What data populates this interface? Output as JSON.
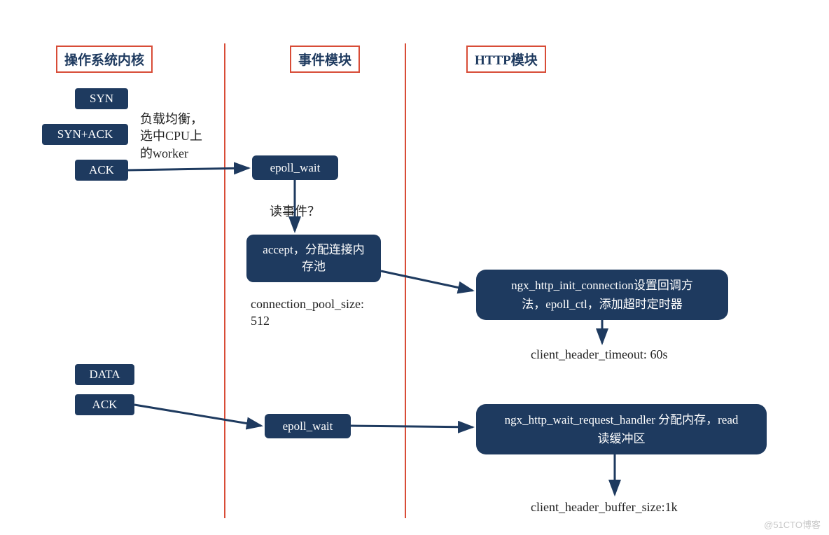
{
  "columns": {
    "kernel_title": "操作系统内核",
    "event_title": "事件模块",
    "http_title": "HTTP模块"
  },
  "kernel": {
    "syn": "SYN",
    "synack": "SYN+ACK",
    "ack": "ACK",
    "data": "DATA",
    "ack2": "ACK",
    "lb_note_line1": "负载均衡，",
    "lb_note_line2": "选中CPU上",
    "lb_note_line3": "的worker"
  },
  "event": {
    "epoll_wait_1": "epoll_wait",
    "epoll_wait_2": "epoll_wait",
    "read_event_q": "读事件？",
    "accept_box_line1": "accept，分配连接内",
    "accept_box_line2": "存池",
    "conn_pool_line1": "connection_pool_size:",
    "conn_pool_line2": "512"
  },
  "http": {
    "init_conn_line1": "ngx_http_init_connection设置回调方",
    "init_conn_line2": "法，epoll_ctl，添加超时定时器",
    "header_timeout": "client_header_timeout: 60s",
    "wait_handler_line1": "ngx_http_wait_request_handler 分配内存，read",
    "wait_handler_line2": "读缓冲区",
    "header_buf": "client_header_buffer_size:1k"
  },
  "watermark": "@51CTO博客"
}
